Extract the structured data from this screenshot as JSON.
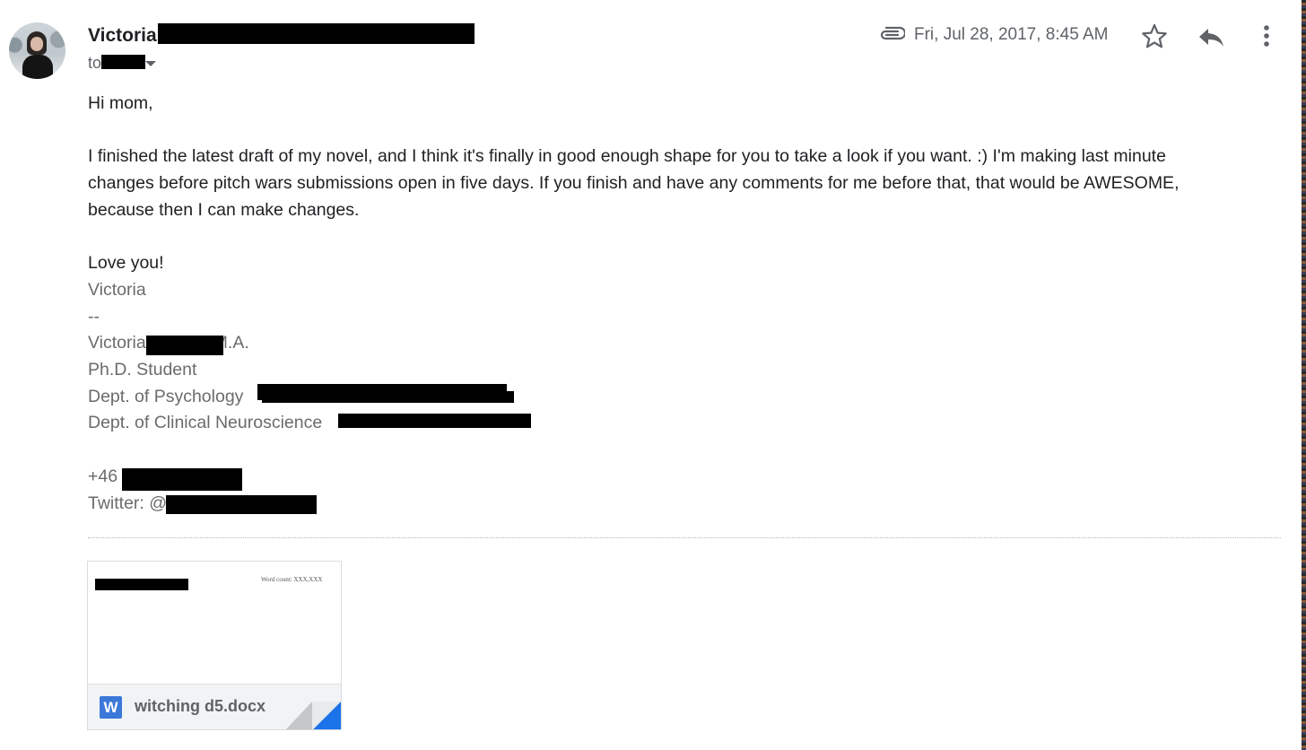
{
  "header": {
    "sender_name": "Victoria",
    "recipient_prefix": "to",
    "date": "Fri, Jul 28, 2017, 8:45 AM",
    "icons": [
      "paperclip-icon",
      "star-icon",
      "reply-icon",
      "more-vert-icon",
      "chevron-down-icon"
    ]
  },
  "body": {
    "greeting": "Hi mom,",
    "paragraph_lines": [
      "I finished the latest draft of my novel, and I think it's finally in good enough shape for you to take a look if you want. :) I'm making last minute",
      "changes before pitch wars submissions open in five days. If you finish and have any comments for me before that, that would be AWESOME,",
      "because then I can make changes."
    ],
    "closing": "Love you!",
    "signature_name": "Victoria",
    "signature_separator": "--",
    "signature_full_name": "Victoria",
    "signature_degree": "M.A.",
    "signature_title": "Ph.D. Student",
    "signature_dept1": "Dept. of Psychology",
    "signature_dept2": "Dept. of Clinical Neuroscience",
    "signature_phone_prefix": "+46",
    "signature_twitter_prefix": "Twitter: @"
  },
  "attachment": {
    "preview_wordcount": "Word count: XXX,XXX",
    "filename": "witching d5.docx",
    "icon_letter": "W",
    "accent_color": "#3b78d8"
  }
}
